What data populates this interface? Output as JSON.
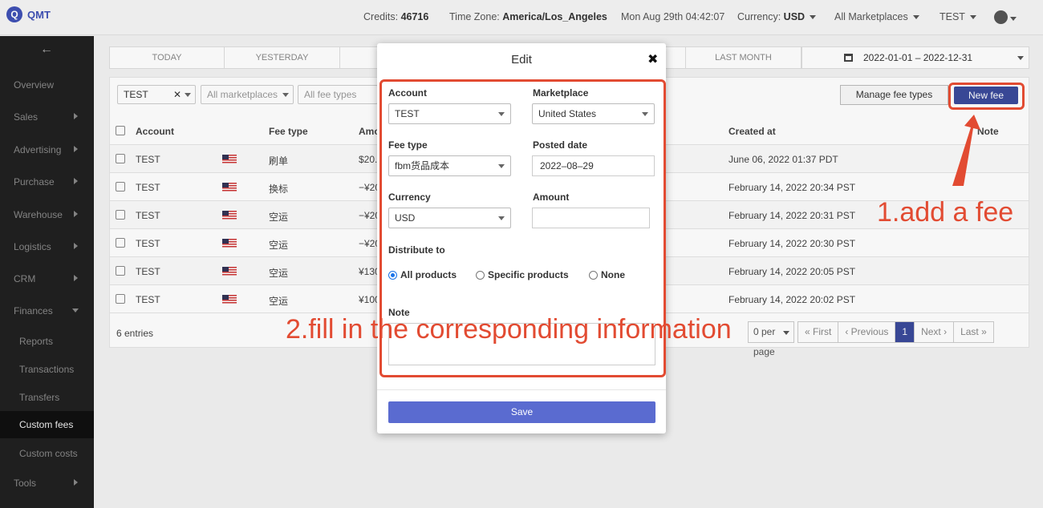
{
  "app": {
    "logo_letter": "Q",
    "name": "QMT"
  },
  "topbar": {
    "credits_label": "Credits:",
    "credits_value": "46716",
    "timezone_label": "Time Zone:",
    "timezone_value": "America/Los_Angeles",
    "datetime": "Mon Aug 29th 04:42:07",
    "currency_label": "Currency:",
    "currency_value": "USD",
    "marketplaces": "All Marketplaces",
    "account": "TEST"
  },
  "sidebar": {
    "back": "←",
    "items": [
      {
        "label": "Overview"
      },
      {
        "label": "Sales"
      },
      {
        "label": "Advertising"
      },
      {
        "label": "Purchase"
      },
      {
        "label": "Warehouse"
      },
      {
        "label": "Logistics"
      },
      {
        "label": "CRM"
      },
      {
        "label": "Finances"
      },
      {
        "label": "Tools"
      }
    ],
    "finance_sub": [
      {
        "label": "Reports"
      },
      {
        "label": "Transactions"
      },
      {
        "label": "Transfers"
      },
      {
        "label": "Custom fees"
      },
      {
        "label": "Custom costs"
      }
    ]
  },
  "date_tabs": {
    "today": "TODAY",
    "yesterday": "YESTERDAY",
    "last_month": "LAST MONTH",
    "range": "2022-01-01 – 2022-12-31"
  },
  "filters": {
    "account": "TEST",
    "marketplaces": "All marketplaces",
    "fee_types": "All fee types"
  },
  "buttons": {
    "manage": "Manage fee types",
    "new_fee": "New fee"
  },
  "table": {
    "headers": {
      "account": "Account",
      "fee_type": "Fee type",
      "amount": "Amo",
      "created_at": "Created at",
      "note": "Note"
    },
    "rows": [
      {
        "account": "TEST",
        "fee_type": "刷单",
        "amount": "$20.",
        "created": "June 06, 2022 01:37 PDT"
      },
      {
        "account": "TEST",
        "fee_type": "换标",
        "amount": "−¥20",
        "created": "February 14, 2022 20:34 PST"
      },
      {
        "account": "TEST",
        "fee_type": "空运",
        "amount": "−¥20",
        "created": "February 14, 2022 20:31 PST"
      },
      {
        "account": "TEST",
        "fee_type": "空运",
        "amount": "−¥20",
        "created": "February 14, 2022 20:30 PST"
      },
      {
        "account": "TEST",
        "fee_type": "空运",
        "amount": "¥130",
        "created": "February 14, 2022 20:05 PST"
      },
      {
        "account": "TEST",
        "fee_type": "空运",
        "amount": "¥100",
        "created": "February 14, 2022 20:02 PST"
      }
    ],
    "entries": "6 entries"
  },
  "pagination": {
    "per_page": "0 per page",
    "first": "« First",
    "previous": "‹ Previous",
    "current": "1",
    "next": "Next ›",
    "last": "Last »"
  },
  "modal": {
    "title": "Edit",
    "close": "✖",
    "account_label": "Account",
    "account_value": "TEST",
    "marketplace_label": "Marketplace",
    "marketplace_value": "United States",
    "fee_type_label": "Fee type",
    "fee_type_value": "fbm货品成本",
    "posted_label": "Posted date",
    "posted_value": "2022–08–29",
    "currency_label": "Currency",
    "currency_value": "USD",
    "amount_label": "Amount",
    "amount_value": "",
    "distribute_label": "Distribute to",
    "radio_all": "All products",
    "radio_specific": "Specific products",
    "radio_none": "None",
    "note_label": "Note",
    "save": "Save"
  },
  "annotations": {
    "step1": "1.add a fee",
    "step2": "2.fill in the corresponding information"
  },
  "colors": {
    "accent": "#3a4a9a",
    "annotation": "#e24b32",
    "save_button": "#5a6bd0"
  }
}
